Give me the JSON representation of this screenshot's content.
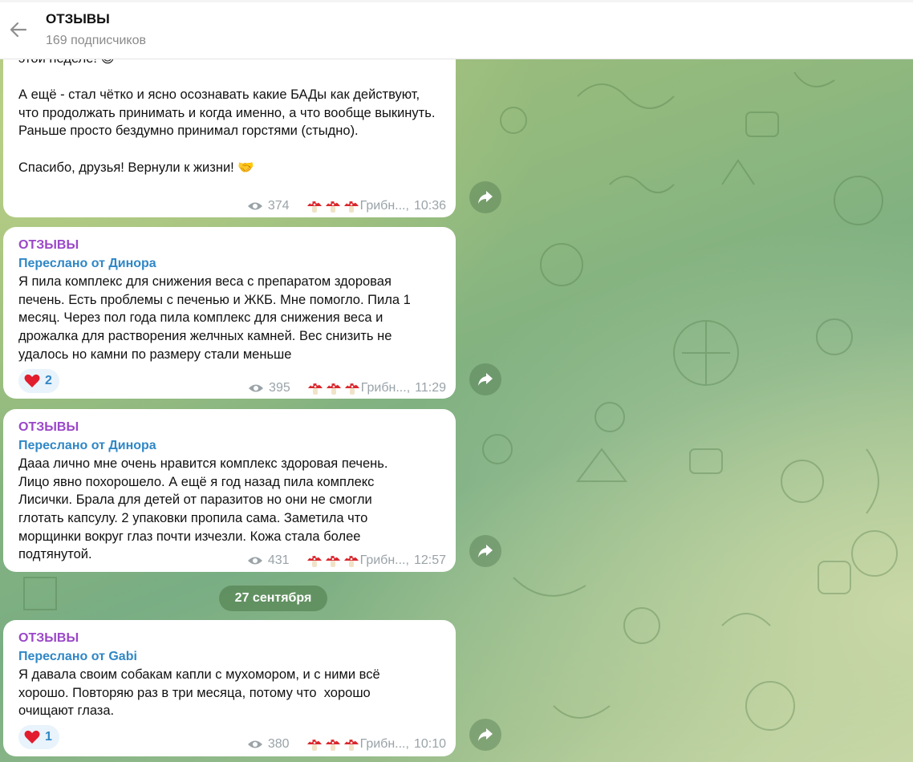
{
  "header": {
    "title": "ОТЗЫВЫ",
    "subscribers": "169 подписчиков"
  },
  "messages": [
    {
      "text_partial": "этой неделе! 😊\n\nА ещё - стал чётко и ясно осознавать какие БАДы как действуют, что продолжать принимать и когда именно, а что вообще выкинуть.\nРаньше просто бездумно принимал горстями (стыдно).\n\nСпасибо, друзья! Вернули к жизни! 🤝",
      "views": "374",
      "signature": "Грибн...,",
      "time": "10:36"
    },
    {
      "channel": "ОТЗЫВЫ",
      "forwarded": "Переслано от Динора",
      "text": "Я пила комплекс для снижения веса с препаратом здоровая печень. Есть проблемы с печенью и ЖКБ. Мне помогло. Пила 1 месяц. Через пол года пила комплекс для снижения веса и дрожалка для растворения желчных камней. Вес снизить не удалось но камни по размеру стали меньше",
      "reaction_count": "2",
      "views": "395",
      "signature": "Грибн...,",
      "time": "11:29"
    },
    {
      "channel": "ОТЗЫВЫ",
      "forwarded": "Переслано от Динора",
      "text": "Дааа лично мне очень нравится комплекс здоровая печень. Лицо явно похорошело. А ещё я год назад пила комплекс Лисички. Брала для детей от паразитов но они не смогли глотать капсулу. 2 упаковки пропила сама. Заметила что морщинки вокруг глаз почти изчезли. Кожа стала более подтянутой.",
      "views": "431",
      "signature": "Грибн...,",
      "time": "12:57"
    },
    {
      "channel": "ОТЗЫВЫ",
      "forwarded": "Переслано от Gabi",
      "text": "Я давала своим собакам капли с мухомором, и с ними всё хорошо. Повторяю раз в три месяца, потому что  хорошо очищают глаза.",
      "reaction_count": "1",
      "views": "380",
      "signature": "Грибн...,",
      "time": "10:10"
    }
  ],
  "date_separator": "27 сентября",
  "colors": {
    "channel_name": "#9a47c8",
    "forward_link": "#2f87c6",
    "meta_gray": "#9aa3a8"
  },
  "icons": [
    "back-arrow-icon",
    "eye-icon",
    "mushroom-icon",
    "heart-icon",
    "share-icon"
  ]
}
